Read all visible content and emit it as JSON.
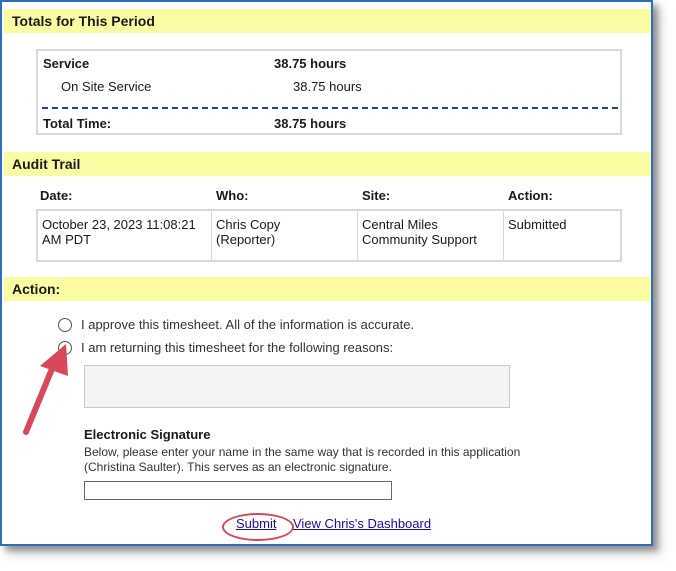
{
  "totals": {
    "header": "Totals for This Period",
    "service_label": "Service",
    "service_value": "38.75 hours",
    "onsite_label": "On Site Service",
    "onsite_value": "38.75 hours",
    "total_label": "Total Time:",
    "total_value": "38.75 hours"
  },
  "audit": {
    "header": "Audit Trail",
    "columns": [
      "Date:",
      "Who:",
      "Site:",
      "Action:"
    ],
    "row": {
      "date_line1": "October 23, 2023 11:08:21",
      "date_line2": "AM PDT",
      "who_line1": "Chris Copy",
      "who_line2": "(Reporter)",
      "site_line1": "Central Miles",
      "site_line2": "Community Support",
      "action": "Submitted"
    }
  },
  "action": {
    "header": "Action:",
    "approve_label": "I approve this timesheet. All of the information is accurate.",
    "return_label": "I am returning this timesheet for the following reasons:",
    "signature_title": "Electronic Signature",
    "signature_desc_line1": "Below, please enter your name in the same way that is recorded in this application",
    "signature_desc_line2": "(Christina Saulter). This serves as an electronic signature.",
    "submit_label": "Submit",
    "dashboard_label": "View Chris's Dashboard"
  },
  "colors": {
    "section_header_bg": "#fbfba4",
    "frame_border": "#2f6ebf",
    "annotation": "#d9475a",
    "link": "#1a0dab"
  }
}
